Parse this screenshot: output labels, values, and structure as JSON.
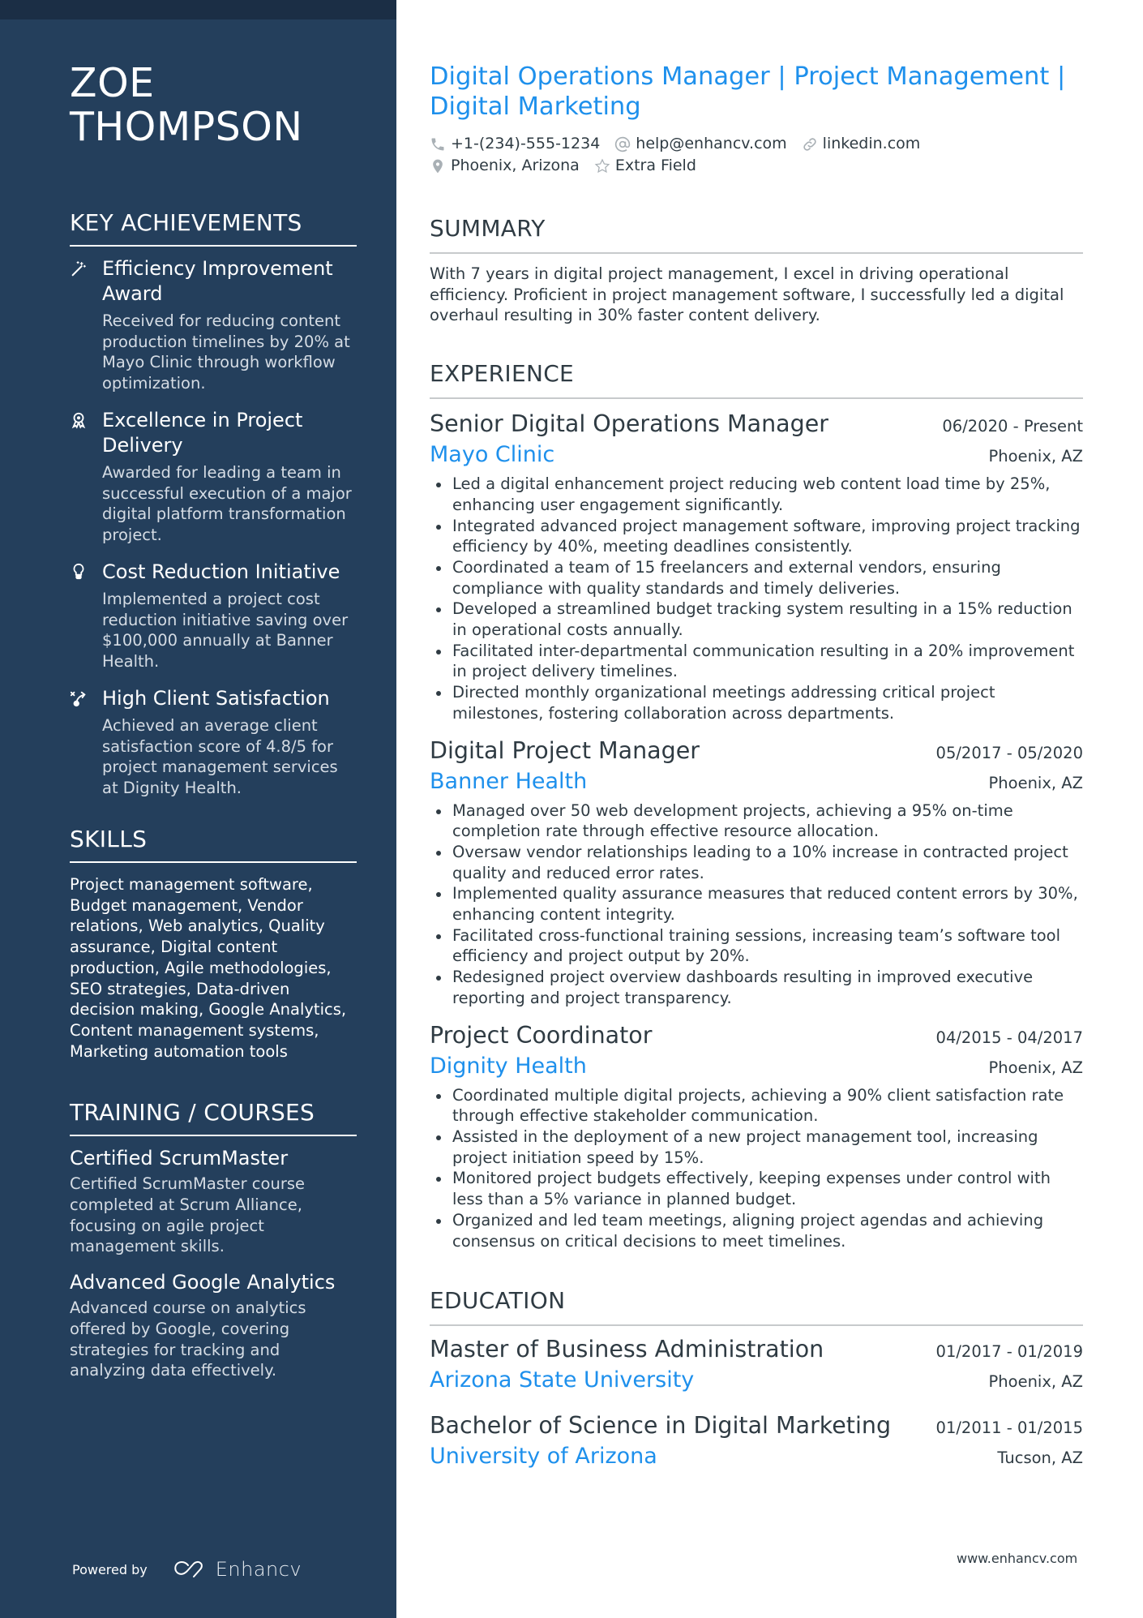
{
  "sidebar": {
    "name_line1": "ZOE",
    "name_line2": "THOMPSON",
    "achievements_heading": "KEY ACHIEVEMENTS",
    "achievements": [
      {
        "icon": "magic-wand-icon",
        "title": "Efficiency Improvement Award",
        "desc": "Received for reducing content production timelines by 20% at Mayo Clinic through workflow optimization."
      },
      {
        "icon": "award-ribbon-icon",
        "title": "Excellence in Project Delivery",
        "desc": "Awarded for leading a team in successful execution of a major digital platform transformation project."
      },
      {
        "icon": "lightbulb-icon",
        "title": "Cost Reduction Initiative",
        "desc": "Implemented a project cost reduction initiative saving over $100,000 annually at Banner Health."
      },
      {
        "icon": "strategy-path-icon",
        "title": "High Client Satisfaction",
        "desc": "Achieved an average client satisfaction score of 4.8/5 for project management services at Dignity Health."
      }
    ],
    "skills_heading": "SKILLS",
    "skills_text": "Project management software, Budget management, Vendor relations, Web analytics, Quality assurance, Digital content production, Agile methodologies, SEO strategies, Data-driven decision making, Google Analytics, Content management systems, Marketing automation tools",
    "training_heading": "TRAINING / COURSES",
    "courses": [
      {
        "title": "Certified ScrumMaster",
        "desc": "Certified ScrumMaster course completed at Scrum Alliance, focusing on agile project management skills."
      },
      {
        "title": "Advanced Google Analytics",
        "desc": "Advanced course on analytics offered by Google, covering strategies for tracking and analyzing data effectively."
      }
    ],
    "powered_by": "Powered by",
    "brand": "Enhancv"
  },
  "header": {
    "headline": "Digital Operations Manager | Project Management | Digital Marketing",
    "phone": "+1-(234)-555-1234",
    "email": "help@enhancv.com",
    "website": "linkedin.com",
    "location": "Phoenix, Arizona",
    "extra": "Extra Field"
  },
  "summary": {
    "heading": "SUMMARY",
    "text": "With 7 years in digital project management, I excel in driving operational efficiency. Proficient in project management software, I successfully led a digital overhaul resulting in 30% faster content delivery."
  },
  "experience": {
    "heading": "EXPERIENCE",
    "jobs": [
      {
        "title": "Senior Digital Operations Manager",
        "dates": "06/2020 - Present",
        "company": "Mayo Clinic",
        "location": "Phoenix, AZ",
        "bullets": [
          "Led a digital enhancement project reducing web content load time by 25%, enhancing user engagement significantly.",
          "Integrated advanced project management software, improving project tracking efficiency by 40%, meeting deadlines consistently.",
          "Coordinated a team of 15 freelancers and external vendors, ensuring compliance with quality standards and timely deliveries.",
          "Developed a streamlined budget tracking system resulting in a 15% reduction in operational costs annually.",
          "Facilitated inter-departmental communication resulting in a 20% improvement in project delivery timelines.",
          "Directed monthly organizational meetings addressing critical project milestones, fostering collaboration across departments."
        ]
      },
      {
        "title": "Digital Project Manager",
        "dates": "05/2017 - 05/2020",
        "company": "Banner Health",
        "location": "Phoenix, AZ",
        "bullets": [
          "Managed over 50 web development projects, achieving a 95% on-time completion rate through effective resource allocation.",
          "Oversaw vendor relationships leading to a 10% increase in contracted project quality and reduced error rates.",
          "Implemented quality assurance measures that reduced content errors by 30%, enhancing content integrity.",
          "Facilitated cross-functional training sessions, increasing team’s software tool efficiency and project output by 20%.",
          "Redesigned project overview dashboards resulting in improved executive reporting and project transparency."
        ]
      },
      {
        "title": "Project Coordinator",
        "dates": "04/2015 - 04/2017",
        "company": "Dignity Health",
        "location": "Phoenix, AZ",
        "bullets": [
          "Coordinated multiple digital projects, achieving a 90% client satisfaction rate through effective stakeholder communication.",
          "Assisted in the deployment of a new project management tool, increasing project initiation speed by 15%.",
          "Monitored project budgets effectively, keeping expenses under control with less than a 5% variance in planned budget.",
          "Organized and led team meetings, aligning project agendas and achieving consensus on critical decisions to meet timelines."
        ]
      }
    ]
  },
  "education": {
    "heading": "EDUCATION",
    "items": [
      {
        "degree": "Master of Business Administration",
        "dates": "01/2017 - 01/2019",
        "school": "Arizona State University",
        "location": "Phoenix, AZ"
      },
      {
        "degree": "Bachelor of Science in Digital Marketing",
        "dates": "01/2011 - 01/2015",
        "school": "University of Arizona",
        "location": "Tucson, AZ"
      }
    ]
  },
  "footer": {
    "url": "www.enhancv.com"
  },
  "colors": {
    "sidebar_bg": "#243f5c",
    "topband_bg": "#1b2e45",
    "accent": "#1e90ec",
    "text": "#2f3b43"
  }
}
